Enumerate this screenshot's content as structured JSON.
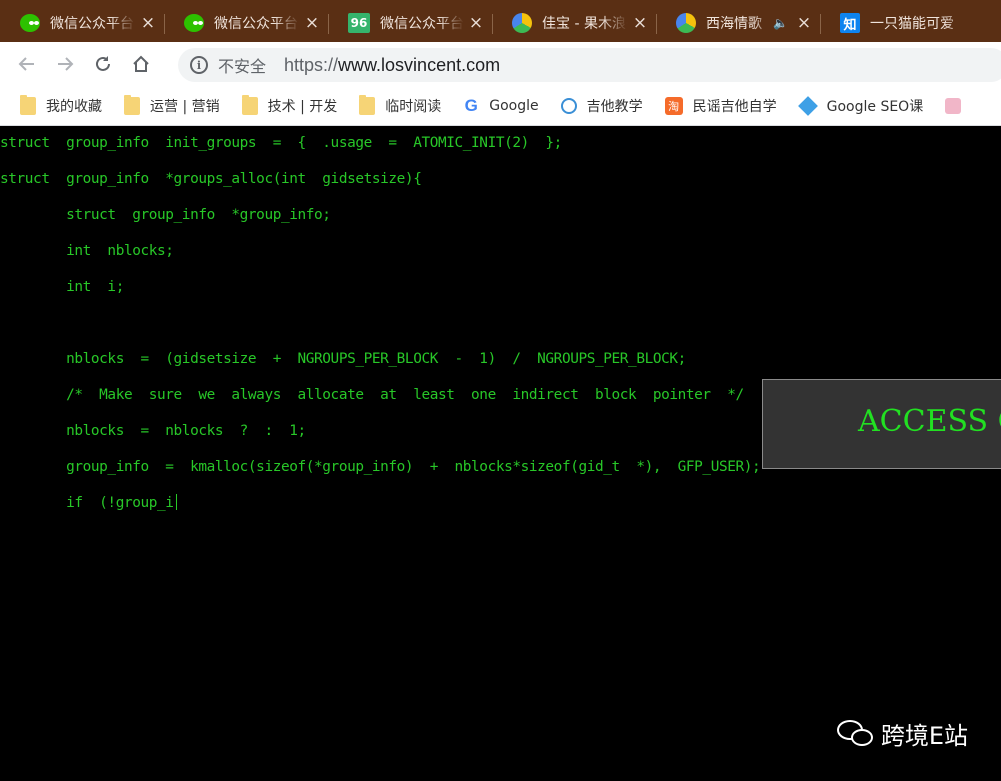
{
  "tabs": [
    {
      "title": "微信公众平台",
      "favicon": "wechat-icon",
      "close": "×"
    },
    {
      "title": "微信公众平台",
      "favicon": "wechat-icon",
      "close": "×"
    },
    {
      "title": "微信公众平台",
      "favicon_text": "96",
      "close": "×"
    },
    {
      "title": "佳宝 - 果木浪子",
      "favicon": "play-icon",
      "close": "×"
    },
    {
      "title": "西海情歌",
      "favicon": "play-icon",
      "mute": "🔈",
      "close": "×"
    },
    {
      "title": "一只猫能可爱",
      "favicon_text": "知",
      "close": "×"
    }
  ],
  "toolbar": {
    "security": "不安全",
    "url_scheme": "https://",
    "url_host": "www.losvincent.com"
  },
  "bookmarks": [
    {
      "label": "我的收藏",
      "icon": "folder-icon"
    },
    {
      "label": "运营 | 营销",
      "icon": "folder-icon"
    },
    {
      "label": "技术 | 开发",
      "icon": "folder-icon"
    },
    {
      "label": "临时阅读",
      "icon": "folder-icon"
    },
    {
      "label": "Google",
      "icon": "google-icon",
      "icon_text": "G"
    },
    {
      "label": "吉他教学",
      "icon": "guitar-icon"
    },
    {
      "label": "民谣吉他自学",
      "icon": "taobao-icon",
      "icon_text": "淘"
    },
    {
      "label": "Google SEO课",
      "icon": "diamond-icon"
    }
  ],
  "code": [
    "struct  group_info  init_groups  =  {  .usage  =  ATOMIC_INIT(2)  };",
    "struct  group_info  *groups_alloc(int  gidsetsize){",
    "        struct  group_info  *group_info;",
    "        int  nblocks;",
    "        int  i;",
    "",
    "        nblocks  =  (gidsetsize  +  NGROUPS_PER_BLOCK  -  1)  /  NGROUPS_PER_BLOCK;",
    "        /*  Make  sure  we  always  allocate  at  least  one  indirect  block  pointer  */",
    "        nblocks  =  nblocks  ?  :  1;",
    "        group_info  =  kmalloc(sizeof(*group_info)  +  nblocks*sizeof(gid_t  *),  GFP_USER);",
    "        if  (!group_i"
  ],
  "overlay": {
    "text": "ACCESS GR"
  },
  "watermark": {
    "text": "跨境E站"
  },
  "colors": {
    "terminal_text": "#28c728",
    "tabstrip": "#5a2f14",
    "access_text": "#22e022"
  }
}
